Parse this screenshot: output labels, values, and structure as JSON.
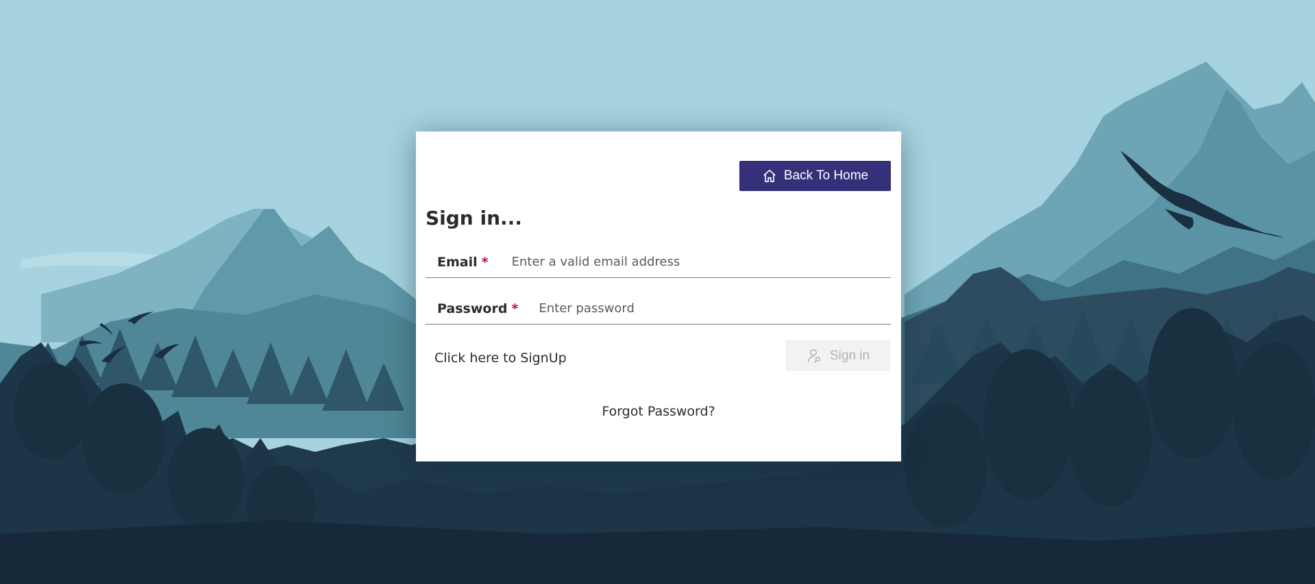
{
  "header": {
    "back_label": "Back To Home",
    "back_icon": "home-icon"
  },
  "form": {
    "title": "Sign in...",
    "email": {
      "label": "Email",
      "required_mark": "*",
      "placeholder": "Enter a valid email address",
      "value": ""
    },
    "password": {
      "label": "Password",
      "required_mark": "*",
      "placeholder": "Enter password",
      "value": ""
    },
    "signup_label": "Click here to SignUp",
    "signin_label": "Sign in",
    "signin_icon": "user-key-icon",
    "forgot_label": "Forgot Password?"
  },
  "colors": {
    "sky": "#a6d3df",
    "primary_button": "#35307a",
    "required": "#b3122f",
    "disabled_button": "#f3f2f1",
    "disabled_text": "#b4b2b0"
  }
}
